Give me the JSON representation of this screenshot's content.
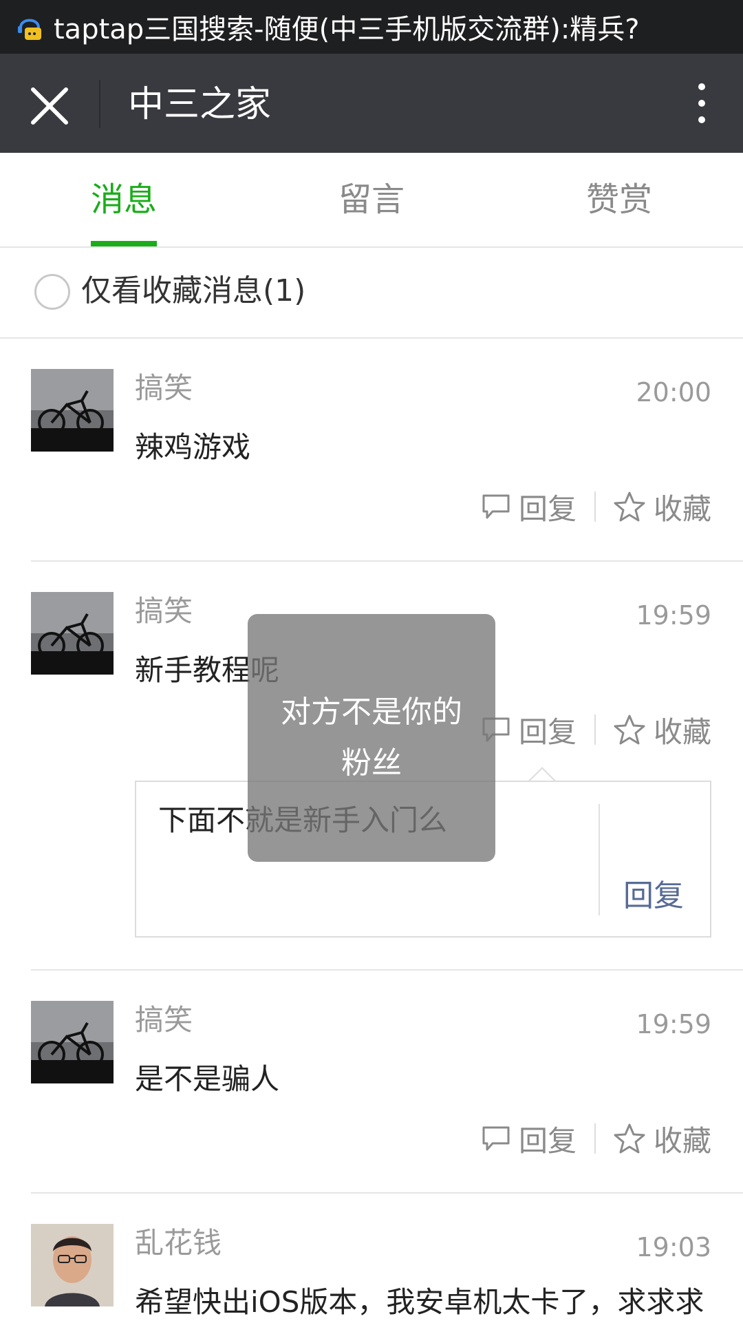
{
  "status_bar": {
    "notification_text": "taptap三国搜索-随便(中三手机版交流群):精兵?"
  },
  "header": {
    "title": "中三之家"
  },
  "tabs": [
    {
      "label": "消息",
      "active": true
    },
    {
      "label": "留言",
      "active": false
    },
    {
      "label": "赞赏",
      "active": false
    }
  ],
  "filter": {
    "label": "仅看收藏消息(1)"
  },
  "messages": [
    {
      "name": "搞笑",
      "time": "20:00",
      "content": "辣鸡游戏",
      "reply": "回复",
      "favorite": "收藏"
    },
    {
      "name": "搞笑",
      "time": "19:59",
      "content": "新手教程呢",
      "reply": "回复",
      "favorite": "收藏"
    },
    {
      "name": "搞笑",
      "time": "19:59",
      "content": "是不是骗人",
      "reply": "回复",
      "favorite": "收藏"
    },
    {
      "name": "乱花钱",
      "time": "19:03",
      "content": "希望快出iOS版本，我安卓机太卡了，求求求"
    }
  ],
  "reply_box": {
    "text": "下面不就是新手入门么",
    "button": "回复"
  },
  "toast": {
    "text": "对方不是你的粉丝"
  },
  "colors": {
    "accent_green": "#1aad19",
    "link_blue": "#576b95",
    "header_bg": "#393a3f"
  },
  "icons": [
    "notification-bot-icon",
    "close-icon",
    "more-vertical-icon",
    "comment-icon",
    "star-icon"
  ]
}
